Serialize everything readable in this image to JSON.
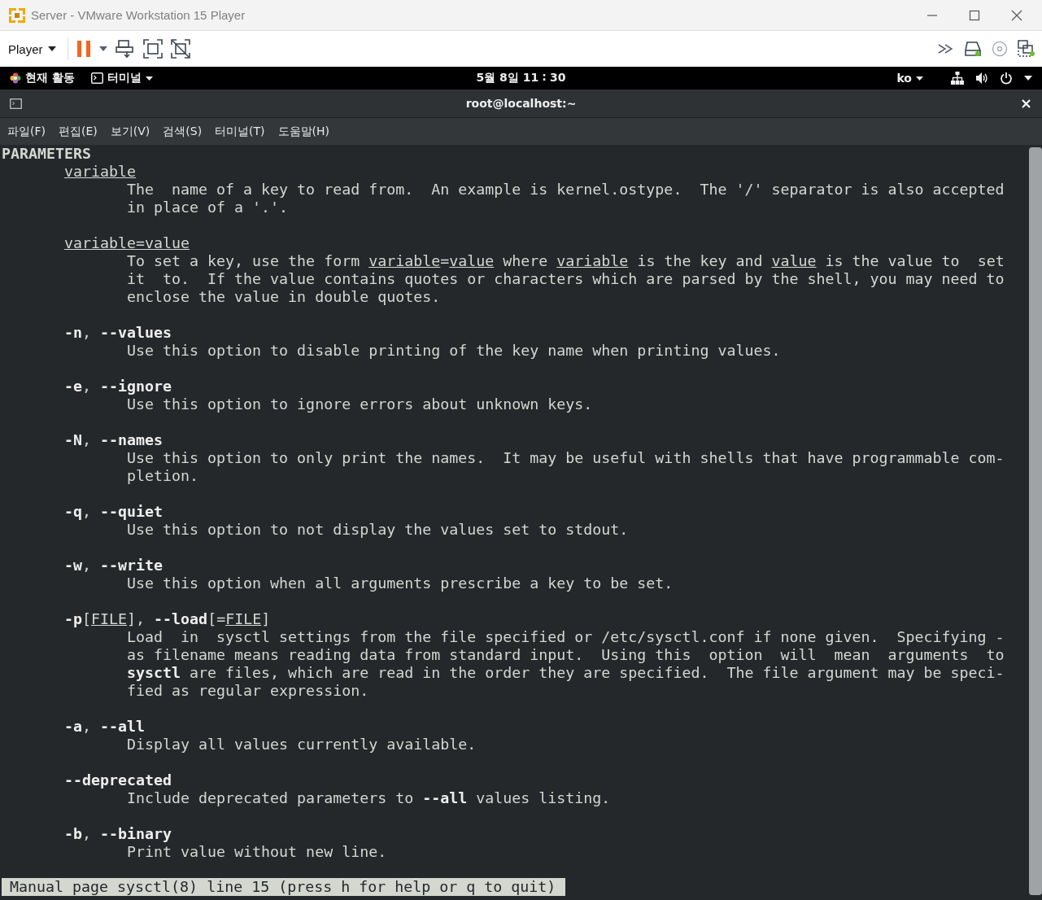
{
  "window": {
    "title": "Server - VMware Workstation 15 Player"
  },
  "toolbar": {
    "player_menu": "Player"
  },
  "guest_top_bar": {
    "activities": "현재 활동",
    "app_menu": "터미널",
    "clock": "5월 8일 11 ∶ 30",
    "input_method": "ko"
  },
  "terminal": {
    "title": "root@localhost:~",
    "menu": [
      "파일(F)",
      "편집(E)",
      "보기(V)",
      "검색(S)",
      "터미널(T)",
      "도움말(H)"
    ],
    "man_page": {
      "heading": "PARAMETERS",
      "entries": [
        {
          "term": [
            {
              "text": "variable",
              "kind": "underline"
            }
          ],
          "description": [
            "The  name of a key to read from.  An example is kernel.ostype.  The '/' separator is also accepted",
            "in place of a '.'."
          ]
        },
        {
          "term": [
            {
              "text": "variable=value",
              "kind": "underline"
            }
          ],
          "description": [
            [
              {
                "text": "To set a key, use the form ",
                "kind": "plain"
              },
              {
                "text": "variable",
                "kind": "underline"
              },
              {
                "text": "=",
                "kind": "plain"
              },
              {
                "text": "value",
                "kind": "underline"
              },
              {
                "text": " where ",
                "kind": "plain"
              },
              {
                "text": "variable",
                "kind": "underline"
              },
              {
                "text": " is the key and ",
                "kind": "plain"
              },
              {
                "text": "value",
                "kind": "underline"
              },
              {
                "text": " is the value to  set",
                "kind": "plain"
              }
            ],
            "it  to.  If the value contains quotes or characters which are parsed by the shell, you may need to",
            "enclose the value in double quotes."
          ]
        },
        {
          "term": [
            {
              "text": "-n",
              "kind": "bold"
            },
            {
              "text": ", ",
              "kind": "plain"
            },
            {
              "text": "--values",
              "kind": "bold"
            }
          ],
          "description": [
            "Use this option to disable printing of the key name when printing values."
          ]
        },
        {
          "term": [
            {
              "text": "-e",
              "kind": "bold"
            },
            {
              "text": ", ",
              "kind": "plain"
            },
            {
              "text": "--ignore",
              "kind": "bold"
            }
          ],
          "description": [
            "Use this option to ignore errors about unknown keys."
          ]
        },
        {
          "term": [
            {
              "text": "-N",
              "kind": "bold"
            },
            {
              "text": ", ",
              "kind": "plain"
            },
            {
              "text": "--names",
              "kind": "bold"
            }
          ],
          "description": [
            "Use this option to only print the names.  It may be useful with shells that have programmable com‐",
            "pletion."
          ]
        },
        {
          "term": [
            {
              "text": "-q",
              "kind": "bold"
            },
            {
              "text": ", ",
              "kind": "plain"
            },
            {
              "text": "--quiet",
              "kind": "bold"
            }
          ],
          "description": [
            "Use this option to not display the values set to stdout."
          ]
        },
        {
          "term": [
            {
              "text": "-w",
              "kind": "bold"
            },
            {
              "text": ", ",
              "kind": "plain"
            },
            {
              "text": "--write",
              "kind": "bold"
            }
          ],
          "description": [
            "Use this option when all arguments prescribe a key to be set."
          ]
        },
        {
          "term": [
            {
              "text": "-p",
              "kind": "bold"
            },
            {
              "text": "[",
              "kind": "plain"
            },
            {
              "text": "FILE",
              "kind": "underline"
            },
            {
              "text": "], ",
              "kind": "plain"
            },
            {
              "text": "--load",
              "kind": "bold"
            },
            {
              "text": "[=",
              "kind": "plain"
            },
            {
              "text": "FILE",
              "kind": "underline"
            },
            {
              "text": "]",
              "kind": "plain"
            }
          ],
          "description": [
            "Load  in  sysctl settings from the file specified or /etc/sysctl.conf if none given.  Specifying ‐",
            "as filename means reading data from standard input.  Using this  option  will  mean  arguments  to",
            [
              {
                "text": "sysctl",
                "kind": "bold"
              },
              {
                "text": " are files, which are read in the order they are specified.  The file argument may be speci‐",
                "kind": "plain"
              }
            ],
            "fied as regular expression."
          ]
        },
        {
          "term": [
            {
              "text": "-a",
              "kind": "bold"
            },
            {
              "text": ", ",
              "kind": "plain"
            },
            {
              "text": "--all",
              "kind": "bold"
            }
          ],
          "description": [
            "Display all values currently available."
          ]
        },
        {
          "term": [
            {
              "text": "--deprecated",
              "kind": "bold"
            }
          ],
          "description": [
            [
              {
                "text": "Include deprecated parameters to ",
                "kind": "plain"
              },
              {
                "text": "--all",
                "kind": "bold"
              },
              {
                "text": " values listing.",
                "kind": "plain"
              }
            ]
          ]
        },
        {
          "term": [
            {
              "text": "-b",
              "kind": "bold"
            },
            {
              "text": ", ",
              "kind": "plain"
            },
            {
              "text": "--binary",
              "kind": "bold"
            }
          ],
          "description": [
            "Print value without new line."
          ]
        }
      ]
    },
    "status_line": "Manual page sysctl(8) line 15 (press h for help or q to quit)"
  }
}
